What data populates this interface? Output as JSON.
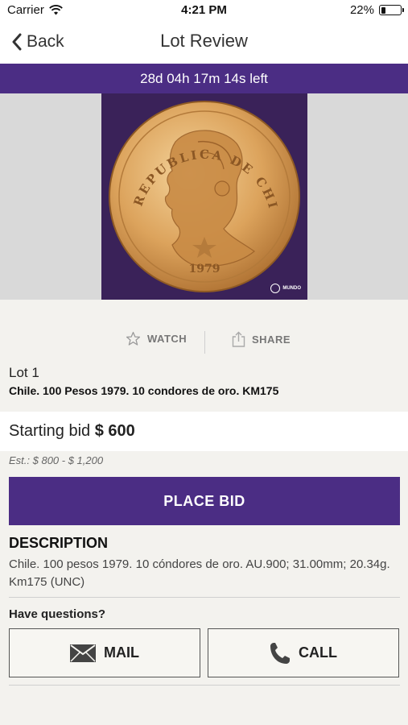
{
  "status_bar": {
    "carrier": "Carrier",
    "time": "4:21 PM",
    "battery": "22%",
    "battery_level": 0.22
  },
  "nav": {
    "back_label": "Back",
    "title": "Lot Review"
  },
  "countdown": "28d 04h 17m 14s left",
  "coin_image": {
    "legend": "REPUBLICA DE CHILE",
    "year": "1979",
    "brand": "MUNDO"
  },
  "actions": {
    "watch_label": "WATCH",
    "share_label": "SHARE"
  },
  "lot": {
    "number": "Lot 1",
    "title": "Chile. 100 Pesos 1979. 10 condores de oro. KM175"
  },
  "bid": {
    "label": "Starting bid",
    "amount": "$ 600",
    "estimate": "Est.: $ 800 - $ 1,200",
    "place_bid_label": "PLACE BID"
  },
  "description": {
    "heading": "DESCRIPTION",
    "text": "Chile. 100 pesos 1979. 10 cóndores de oro. AU.900; 31.00mm; 20.34g. Km175 (UNC)"
  },
  "contact": {
    "question": "Have questions?",
    "mail_label": "MAIL",
    "call_label": "CALL"
  },
  "colors": {
    "accent": "#4b2d84",
    "background": "#f3f2ee",
    "coin_gold": "#d8a25c"
  }
}
